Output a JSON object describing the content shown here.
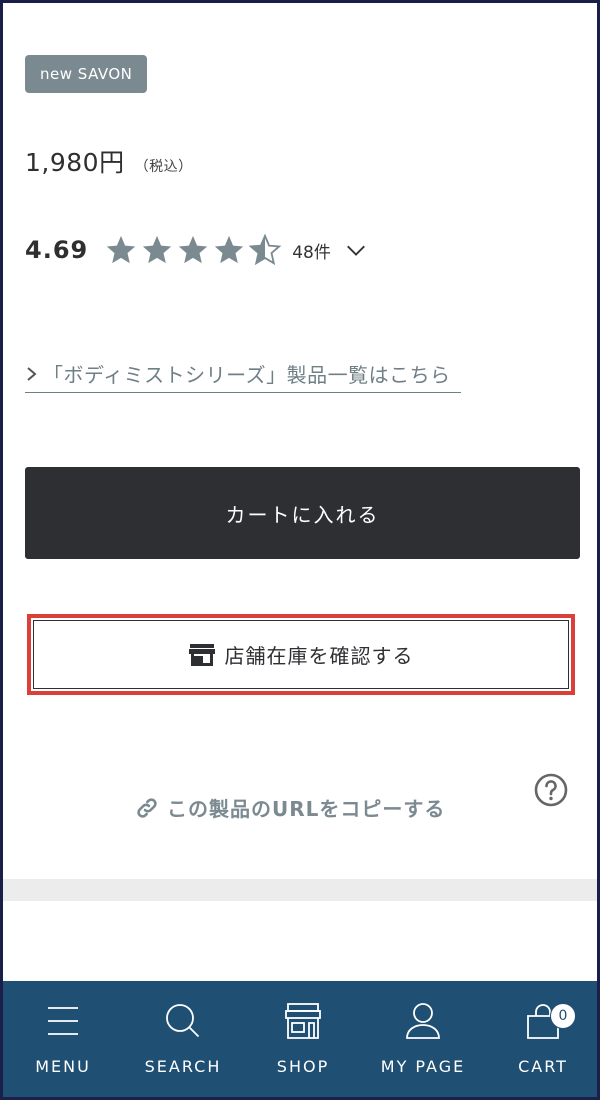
{
  "product": {
    "tag": "new SAVON",
    "price": "1,980円",
    "tax_note": "（税込）",
    "rating_score": "4.69",
    "rating_value": 4.5,
    "rating_max": 5,
    "review_count": "48件"
  },
  "links": {
    "series": "「ボディミストシリーズ」製品一覧はこちら",
    "copy_url": "この製品のURLをコピーする"
  },
  "actions": {
    "add_to_cart": "カートに入れる",
    "check_stock": "店舗在庫を確認する"
  },
  "nav": {
    "menu": "MENU",
    "search": "SEARCH",
    "shop": "SHOP",
    "mypage": "MY PAGE",
    "cart": "CART",
    "cart_count": "0"
  },
  "colors": {
    "tag_bg": "#7b8a91",
    "button_dark": "#2e2f33",
    "highlight": "#d9403a",
    "nav_bg": "#1f4f72"
  }
}
